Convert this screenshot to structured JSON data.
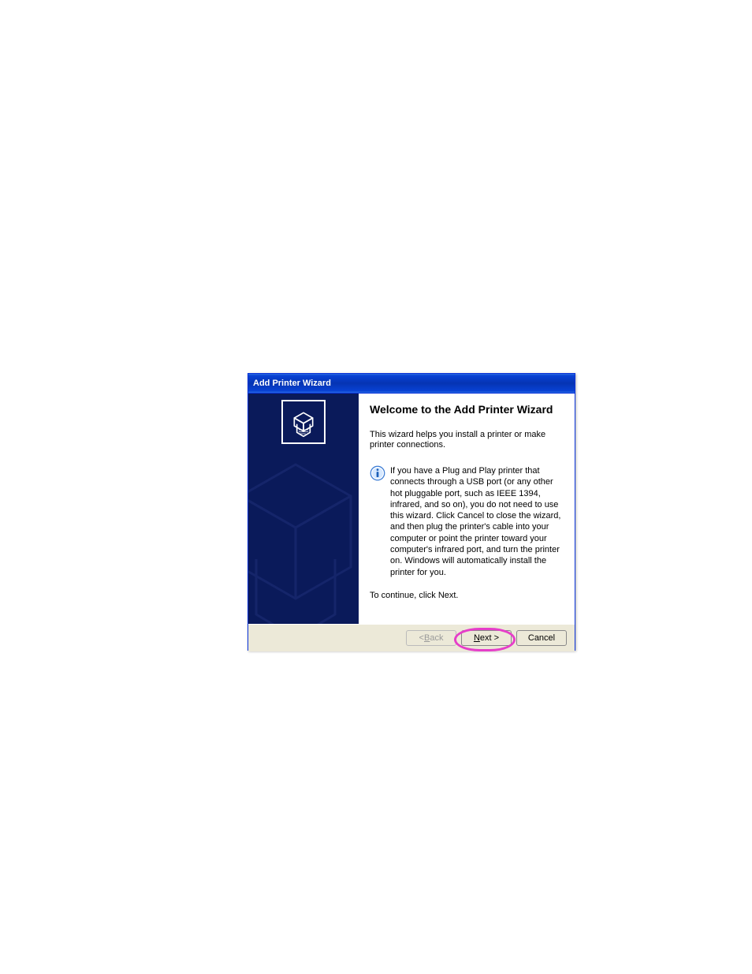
{
  "dialog": {
    "title": "Add Printer Wizard",
    "heading": "Welcome to the Add Printer Wizard",
    "intro": "This wizard helps you install a printer or make printer connections.",
    "info": "If you have a Plug and Play printer that connects through a USB port (or any other hot pluggable port, such as IEEE 1394, infrared, and so on), you do not need to use this wizard. Click Cancel to close the wizard, and then plug the printer's cable into your computer or point the printer toward your computer's infrared port, and turn the printer on. Windows will automatically install the printer for you.",
    "continue": "To continue, click Next.",
    "buttons": {
      "back": "< Back",
      "back_accessKey": "B",
      "next": "Next >",
      "next_accessKey": "N",
      "cancel": "Cancel"
    }
  }
}
